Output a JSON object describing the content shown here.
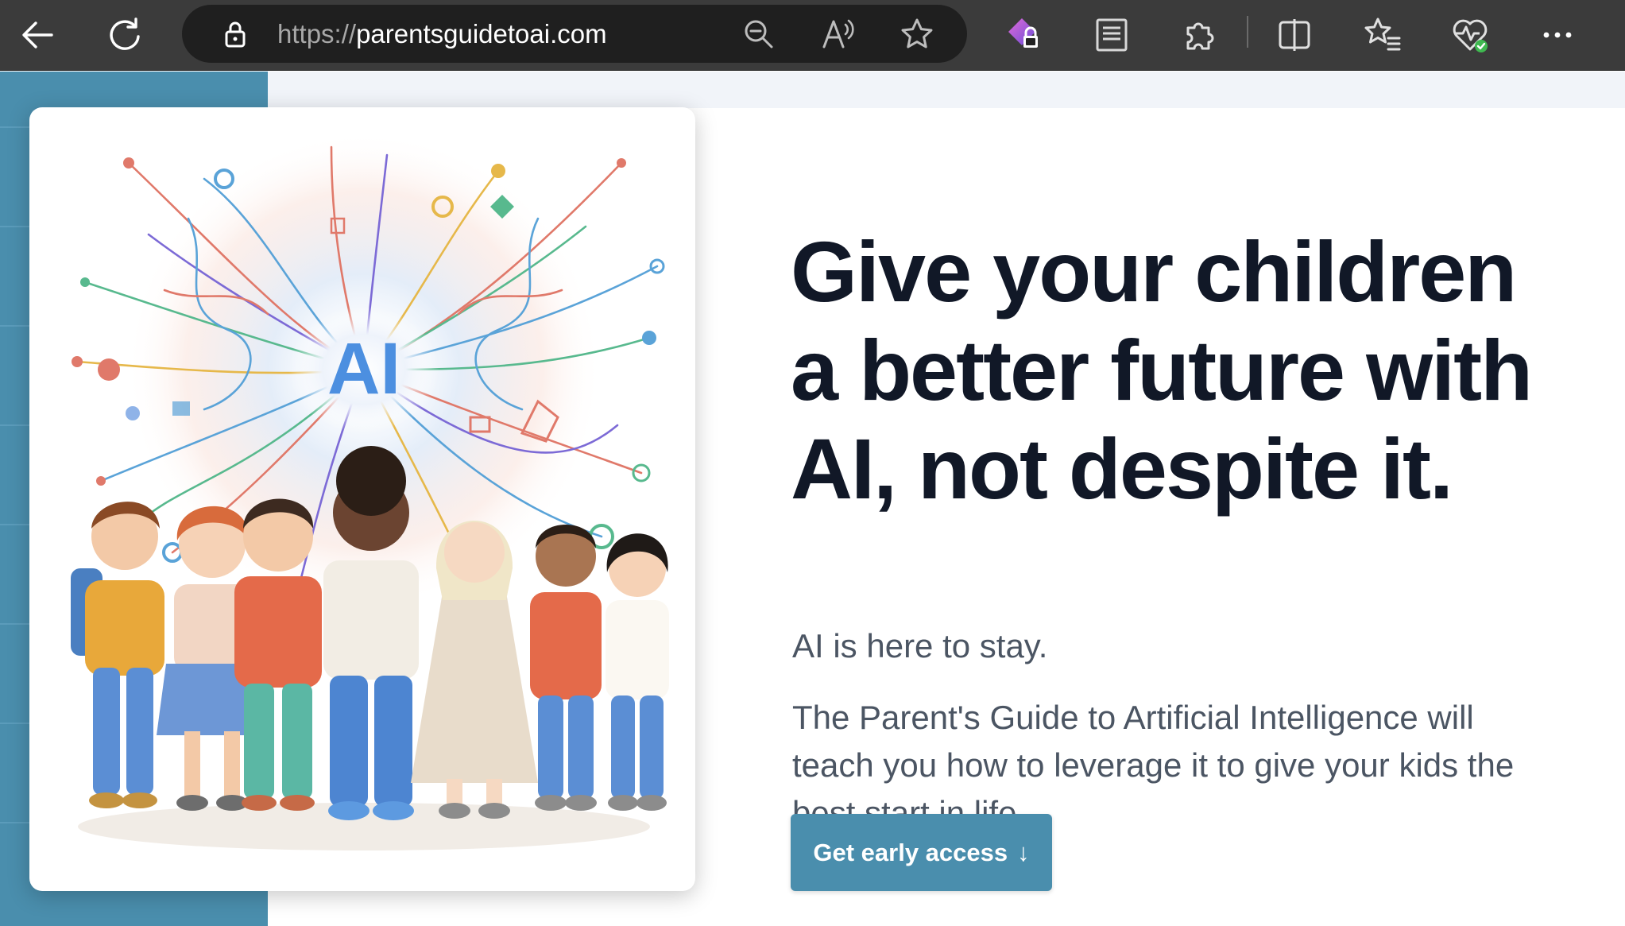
{
  "browser": {
    "url_protocol": "https://",
    "url_domain": "parentsguidetoai.com",
    "icons": [
      "back-arrow-icon",
      "refresh-icon",
      "lock-icon",
      "zoom-out-icon",
      "read-aloud-icon",
      "favorite-star-icon",
      "shield-lock-extension-icon",
      "reader-view-icon",
      "extensions-puzzle-icon",
      "split-screen-icon",
      "favorites-list-icon",
      "browser-health-icon",
      "more-options-icon"
    ]
  },
  "hero": {
    "image_text": "AI",
    "headline_lines": [
      "Give your children",
      "a better future with",
      "AI, not despite it."
    ],
    "tagline": "AI is here to stay.",
    "description_lines": [
      "The Parent's Guide to Artificial Intelligence will",
      "teach you how to leverage it to give your kids the",
      "best start in life."
    ],
    "cta_label": "Get early access",
    "cta_icon": "↓"
  },
  "colors": {
    "toolbar": "#3b3b3b",
    "accent": "#4a8ead",
    "headline": "#111827",
    "body_text": "#4b5563"
  }
}
